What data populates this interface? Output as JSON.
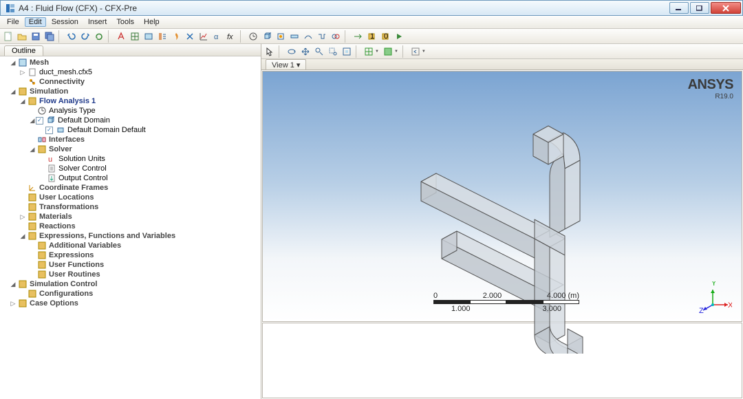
{
  "window": {
    "title": "A4 : Fluid Flow (CFX) - CFX-Pre"
  },
  "menu": {
    "items": [
      "File",
      "Edit",
      "Session",
      "Insert",
      "Tools",
      "Help"
    ],
    "open": 1
  },
  "outline": {
    "tab": "Outline"
  },
  "tree": {
    "mesh": "Mesh",
    "mesh_file": "duct_mesh.cfx5",
    "connectivity": "Connectivity",
    "simulation": "Simulation",
    "flow_analysis": "Flow Analysis 1",
    "analysis_type": "Analysis Type",
    "default_domain": "Default Domain",
    "default_domain_default": "Default Domain Default",
    "interfaces": "Interfaces",
    "solver": "Solver",
    "solution_units": "Solution Units",
    "solver_control": "Solver Control",
    "output_control": "Output Control",
    "coord_frames": "Coordinate Frames",
    "user_locations": "User Locations",
    "transformations": "Transformations",
    "materials": "Materials",
    "reactions": "Reactions",
    "expr_funcs": "Expressions, Functions and Variables",
    "add_vars": "Additional Variables",
    "expressions": "Expressions",
    "user_functions": "User Functions",
    "user_routines": "User Routines",
    "sim_control": "Simulation Control",
    "configurations": "Configurations",
    "case_options": "Case Options"
  },
  "view": {
    "tab": "View 1 ▾"
  },
  "brand": {
    "name": "ANSYS",
    "version": "R19.0"
  },
  "scale": {
    "top": [
      "0",
      "2.000",
      "4.000  (m)"
    ],
    "bot": [
      "1.000",
      "3.000"
    ]
  },
  "triad": {
    "x": "X",
    "y": "Y",
    "z": "Z"
  }
}
